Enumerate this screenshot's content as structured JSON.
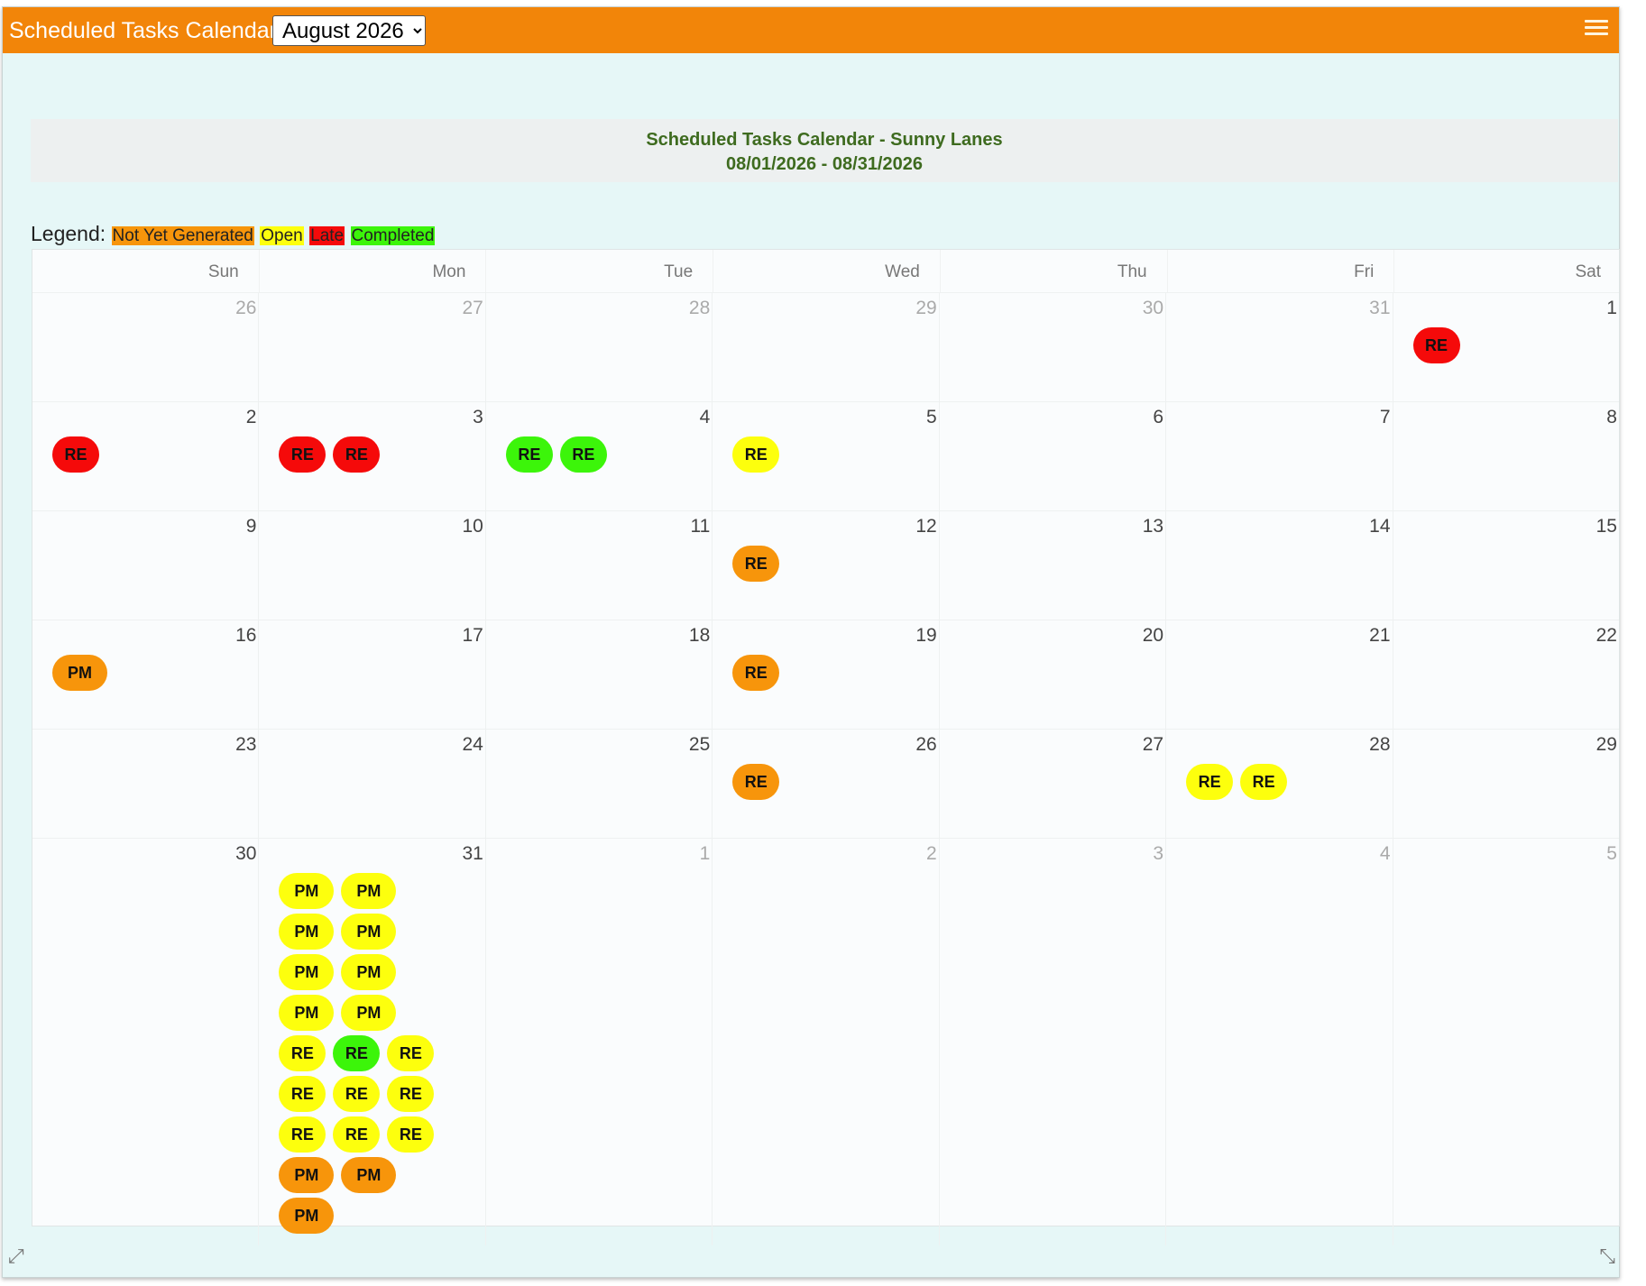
{
  "app": {
    "title": "Scheduled Tasks Calendar",
    "month_selected": "August 2026"
  },
  "report": {
    "title": "Scheduled Tasks Calendar - Sunny Lanes",
    "range": "08/01/2026 - 08/31/2026"
  },
  "legend": {
    "label": "Legend:",
    "items": [
      {
        "label": "Not Yet Generated",
        "color": "#f7950b"
      },
      {
        "label": "Open",
        "color": "#fdff0d"
      },
      {
        "label": "Late",
        "color": "#f50a0a"
      },
      {
        "label": "Completed",
        "color": "#3cf50a"
      }
    ]
  },
  "weekdays": [
    "Sun",
    "Mon",
    "Tue",
    "Wed",
    "Thu",
    "Fri",
    "Sat"
  ],
  "weeks": [
    [
      {
        "num": "26",
        "other": true,
        "tasks": []
      },
      {
        "num": "27",
        "other": true,
        "tasks": []
      },
      {
        "num": "28",
        "other": true,
        "tasks": []
      },
      {
        "num": "29",
        "other": true,
        "tasks": []
      },
      {
        "num": "30",
        "other": true,
        "tasks": []
      },
      {
        "num": "31",
        "other": true,
        "tasks": []
      },
      {
        "num": "1",
        "other": false,
        "tasks": [
          {
            "label": "RE",
            "status": "late"
          }
        ]
      }
    ],
    [
      {
        "num": "2",
        "other": false,
        "tasks": [
          {
            "label": "RE",
            "status": "late"
          }
        ]
      },
      {
        "num": "3",
        "other": false,
        "tasks": [
          {
            "label": "RE",
            "status": "late"
          },
          {
            "label": "RE",
            "status": "late"
          }
        ]
      },
      {
        "num": "4",
        "other": false,
        "tasks": [
          {
            "label": "RE",
            "status": "done"
          },
          {
            "label": "RE",
            "status": "done"
          }
        ]
      },
      {
        "num": "5",
        "other": false,
        "tasks": [
          {
            "label": "RE",
            "status": "open"
          }
        ]
      },
      {
        "num": "6",
        "other": false,
        "tasks": []
      },
      {
        "num": "7",
        "other": false,
        "tasks": []
      },
      {
        "num": "8",
        "other": false,
        "tasks": []
      }
    ],
    [
      {
        "num": "9",
        "other": false,
        "tasks": []
      },
      {
        "num": "10",
        "other": false,
        "tasks": []
      },
      {
        "num": "11",
        "other": false,
        "tasks": []
      },
      {
        "num": "12",
        "other": false,
        "tasks": [
          {
            "label": "RE",
            "status": "ng"
          }
        ]
      },
      {
        "num": "13",
        "other": false,
        "tasks": []
      },
      {
        "num": "14",
        "other": false,
        "tasks": []
      },
      {
        "num": "15",
        "other": false,
        "tasks": []
      }
    ],
    [
      {
        "num": "16",
        "other": false,
        "tasks": [
          {
            "label": "PM",
            "status": "ng"
          }
        ]
      },
      {
        "num": "17",
        "other": false,
        "tasks": []
      },
      {
        "num": "18",
        "other": false,
        "tasks": []
      },
      {
        "num": "19",
        "other": false,
        "tasks": [
          {
            "label": "RE",
            "status": "ng"
          }
        ]
      },
      {
        "num": "20",
        "other": false,
        "tasks": []
      },
      {
        "num": "21",
        "other": false,
        "tasks": []
      },
      {
        "num": "22",
        "other": false,
        "tasks": []
      }
    ],
    [
      {
        "num": "23",
        "other": false,
        "tasks": []
      },
      {
        "num": "24",
        "other": false,
        "tasks": []
      },
      {
        "num": "25",
        "other": false,
        "tasks": []
      },
      {
        "num": "26",
        "other": false,
        "tasks": [
          {
            "label": "RE",
            "status": "ng"
          }
        ]
      },
      {
        "num": "27",
        "other": false,
        "tasks": []
      },
      {
        "num": "28",
        "other": false,
        "tasks": [
          {
            "label": "RE",
            "status": "open"
          },
          {
            "label": "RE",
            "status": "open"
          }
        ]
      },
      {
        "num": "29",
        "other": false,
        "tasks": []
      }
    ],
    [
      {
        "num": "30",
        "other": false,
        "tasks": []
      },
      {
        "num": "31",
        "other": false,
        "tasks": [
          {
            "label": "PM",
            "status": "open"
          },
          {
            "label": "PM",
            "status": "open"
          },
          {
            "label": "PM",
            "status": "open"
          },
          {
            "label": "PM",
            "status": "open"
          },
          {
            "label": "PM",
            "status": "open"
          },
          {
            "label": "PM",
            "status": "open"
          },
          {
            "label": "PM",
            "status": "open"
          },
          {
            "label": "PM",
            "status": "open"
          },
          {
            "label": "RE",
            "status": "open"
          },
          {
            "label": "RE",
            "status": "done"
          },
          {
            "label": "RE",
            "status": "open"
          },
          {
            "label": "RE",
            "status": "open"
          },
          {
            "label": "RE",
            "status": "open"
          },
          {
            "label": "RE",
            "status": "open"
          },
          {
            "label": "RE",
            "status": "open"
          },
          {
            "label": "RE",
            "status": "open"
          },
          {
            "label": "RE",
            "status": "open"
          },
          {
            "label": "PM",
            "status": "ng"
          },
          {
            "label": "PM",
            "status": "ng"
          },
          {
            "label": "PM",
            "status": "ng"
          }
        ]
      },
      {
        "num": "1",
        "other": true,
        "tasks": []
      },
      {
        "num": "2",
        "other": true,
        "tasks": []
      },
      {
        "num": "3",
        "other": true,
        "tasks": []
      },
      {
        "num": "4",
        "other": true,
        "tasks": []
      },
      {
        "num": "5",
        "other": true,
        "tasks": []
      }
    ]
  ],
  "icons": {
    "menu": "hamburger-menu-icon",
    "resize_left": "resize-diagonal-icon",
    "resize_right": "resize-diagonal-icon"
  }
}
